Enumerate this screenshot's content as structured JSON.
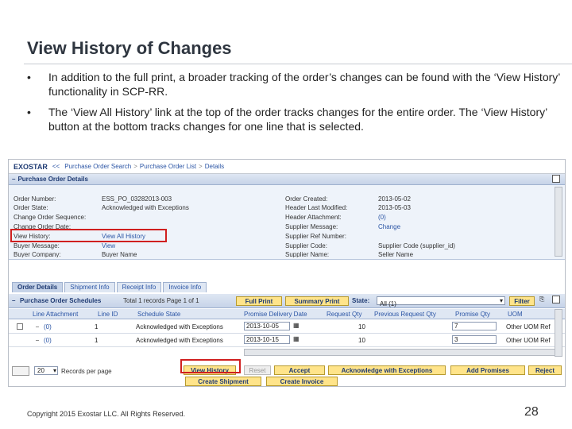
{
  "slide": {
    "title": "View History of Changes",
    "bullets": [
      "In addition to the full print, a broader tracking of the order’s changes can be found with the ‘View History’ functionality in SCP-RR.",
      "The ‘View All History’ link at the top of the order tracks changes for the entire order.  The ‘View History’ button at the bottom tracks changes for one line that is selected."
    ],
    "bullet_symbol": "•",
    "copyright": "Copyright 2015 Exostar LLC. All Rights Reserved.",
    "page_number": "28"
  },
  "app": {
    "brand": "EXOSTAR",
    "breadcrumb": [
      "Purchase Order Search",
      "Purchase Order List",
      "Details"
    ],
    "breadcrumb_back": "<<",
    "breadcrumb_sep": ">",
    "details_header": "Purchase Order Details",
    "details_left": [
      {
        "label": "Order Number:",
        "value": "ESS_PO_03282013-003"
      },
      {
        "label": "Order State:",
        "value": "Acknowledged with Exceptions"
      },
      {
        "label": "Change Order Sequence:",
        "value": ""
      },
      {
        "label": "Change Order Date:",
        "value": ""
      },
      {
        "label": "View History:",
        "value": "View All History"
      },
      {
        "label": "Buyer Message:",
        "value": "View"
      },
      {
        "label": "Buyer Company:",
        "value": "Buyer Name"
      }
    ],
    "details_right": [
      {
        "label": "Order Created:",
        "value": "2013-05-02"
      },
      {
        "label": "Header Last Modified:",
        "value": "2013-05-03"
      },
      {
        "label": "Header Attachment:",
        "value": "(0)"
      },
      {
        "label": "Supplier Message:",
        "value": "Change"
      },
      {
        "label": "Supplier Ref Number:",
        "value": ""
      },
      {
        "label": "Supplier Code:",
        "value": "Supplier Code (supplier_id)"
      },
      {
        "label": "Supplier Name:",
        "value": "Seller Name"
      }
    ],
    "tabs": [
      "Order Details",
      "Shipment Info",
      "Receipt Info",
      "Invoice Info"
    ],
    "schedules": {
      "title": "Purchase Order Schedules",
      "total": "Total 1 records Page 1 of 1",
      "full_print": "Full Print",
      "summary_print": "Summary Print",
      "state_label": "State:",
      "state_value": "All (1)",
      "filter": "Filter",
      "columns": [
        "Line Attachment",
        "Line ID",
        "Schedule State",
        "Promise Delivery Date",
        "Request Qty",
        "Previous Request Qty",
        "Promise Qty",
        "UOM"
      ],
      "rows": [
        {
          "attachment": "(0)",
          "line_id": "1",
          "state": "Acknowledged with Exceptions",
          "date": "2013-10-05",
          "qty": "10",
          "promise": "7",
          "uom": "Other UOM Ref"
        },
        {
          "attachment": "(0)",
          "line_id": "1",
          "state": "Acknowledged with Exceptions",
          "date": "2013-10-15",
          "qty": "10",
          "promise": "3",
          "uom": "Other UOM Ref"
        }
      ]
    },
    "per_page_value": "20",
    "per_page_label": "Records per page",
    "actions": {
      "view_history": "View History",
      "reset": "Reset",
      "accept": "Accept",
      "ack_exceptions": "Acknowledge with Exceptions",
      "add_promises": "Add Promises",
      "reject": "Reject",
      "create_shipment": "Create Shipment",
      "create_invoice": "Create Invoice"
    },
    "colors": {
      "highlight": "#d01f1f",
      "button": "#ffe48a",
      "header": "#c6d3e8"
    }
  }
}
